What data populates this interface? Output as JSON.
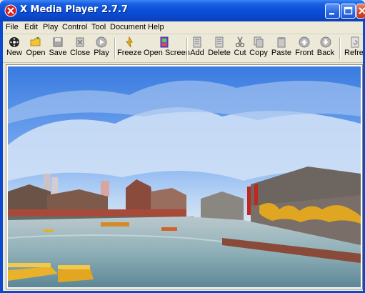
{
  "window": {
    "title": "X Media Player 2.7.7"
  },
  "menu": [
    "File",
    "Edit",
    "Play",
    "Control",
    "Tool",
    "Document",
    "Help"
  ],
  "toolbar": {
    "new": "New",
    "open": "Open",
    "save": "Save",
    "close": "Close",
    "play": "Play",
    "freeze": "Freeze",
    "open_screen": "Open Screen",
    "add": "Add",
    "delete": "Delete",
    "cut": "Cut",
    "copy": "Copy",
    "paste": "Paste",
    "front": "Front",
    "back": "Back",
    "refresh": "Refresh"
  },
  "colors": {
    "titlebar": "#0b4fd8",
    "chrome": "#ece9d8",
    "close_button": "#d9462a"
  },
  "video": {
    "description_icon": "video-frame-image"
  }
}
